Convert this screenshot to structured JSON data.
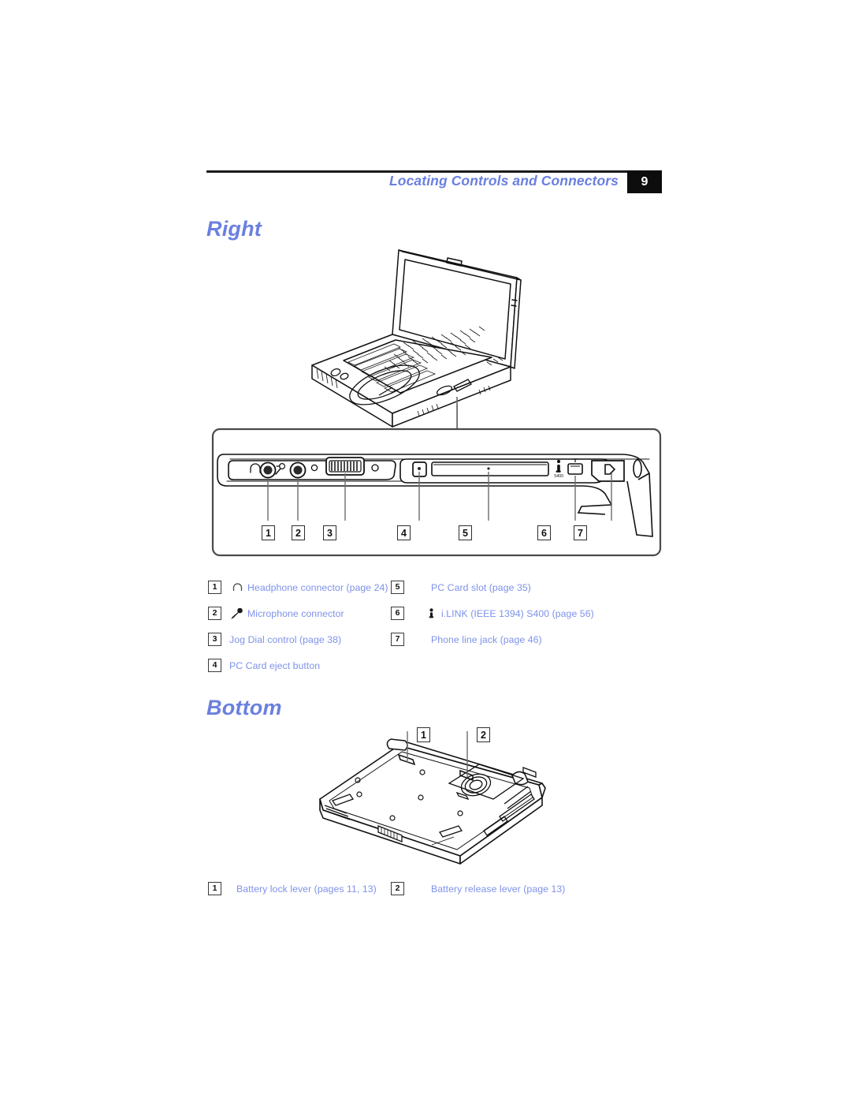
{
  "header": {
    "title": "Locating Controls and Connectors",
    "page_number": "9"
  },
  "sections": [
    {
      "heading": "Right",
      "figure_alt": "VAIO notebook computer shown open, with a detail view of the right-side connector panel",
      "callouts": [
        "1",
        "2",
        "3",
        "4",
        "5",
        "6",
        "7"
      ],
      "legend_left": [
        {
          "num": "1",
          "icon": "headphone-icon",
          "label": "Headphone connector (page 24)"
        },
        {
          "num": "2",
          "icon": "microphone-icon",
          "label": "Microphone connector"
        },
        {
          "num": "3",
          "icon": "",
          "label": "Jog Dial control (page 38)"
        },
        {
          "num": "4",
          "icon": "",
          "label": "PC Card eject button"
        }
      ],
      "legend_right": [
        {
          "num": "5",
          "icon": "",
          "label": "PC Card slot (page 35)"
        },
        {
          "num": "6",
          "icon": "ilink-icon",
          "label": "i.LINK (IEEE 1394) S400 (page 56)"
        },
        {
          "num": "7",
          "icon": "",
          "label": "Phone line jack (page 46)"
        }
      ]
    },
    {
      "heading": "Bottom",
      "figure_alt": "Underside of the notebook computer showing battery levers",
      "callouts": [
        "1",
        "2"
      ],
      "legend_left": [
        {
          "num": "1",
          "icon": "",
          "label": "Battery lock lever (pages 11, 13)"
        }
      ],
      "legend_right": [
        {
          "num": "2",
          "icon": "",
          "label": "Battery release lever (page 13)"
        }
      ]
    }
  ],
  "panel_labels": {
    "ilink_mark": "S400"
  },
  "colors": {
    "accent_blue": "#6a7fe0",
    "legend_blue": "#7e92ea",
    "badge_bg": "#0d0d0d",
    "rule": "#1a1a1a"
  }
}
